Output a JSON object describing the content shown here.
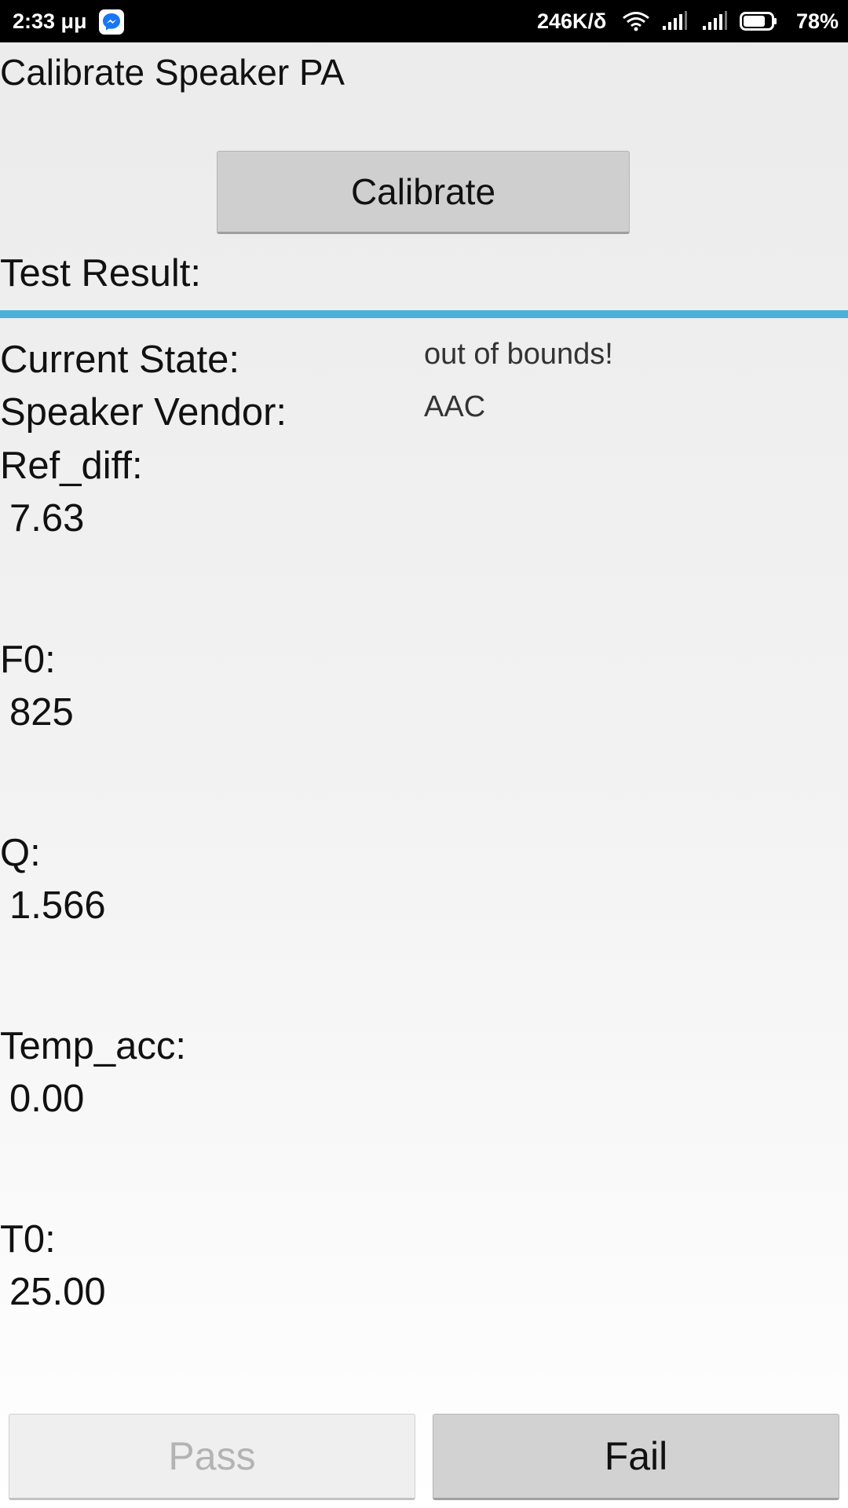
{
  "status_bar": {
    "time": "2:33 μμ",
    "net_speed": "246K/δ",
    "battery_percent": "78%",
    "battery_level": 0.78,
    "icons": [
      "messenger-icon",
      "wifi-icon",
      "signal-icon",
      "signal-icon",
      "battery-icon"
    ]
  },
  "page": {
    "title": "Calibrate Speaker PA",
    "calibrate_button": "Calibrate",
    "test_result_label": "Test Result:",
    "divider_color": "#4bb0da"
  },
  "fields": {
    "current_state": {
      "label": "Current State:",
      "value": "out of bounds!"
    },
    "speaker_vendor": {
      "label": "Speaker Vendor:",
      "value": "AAC"
    },
    "ref_diff": {
      "label": "Ref_diff:",
      "value": "7.63"
    },
    "f0": {
      "label": "F0:",
      "value": "825"
    },
    "q": {
      "label": "Q:",
      "value": "1.566"
    },
    "temp_acc": {
      "label": "Temp_acc:",
      "value": "0.00"
    },
    "t0": {
      "label": "T0:",
      "value": "25.00"
    }
  },
  "actions": {
    "pass_label": "Pass",
    "pass_enabled": false,
    "fail_label": "Fail",
    "fail_enabled": true
  }
}
